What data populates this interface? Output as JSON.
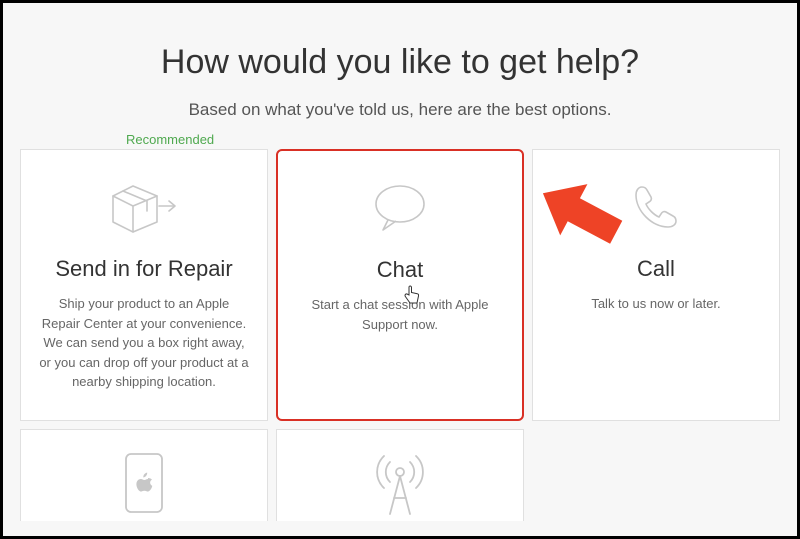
{
  "header": {
    "title": "How would you like to get help?",
    "subtitle": "Based on what you've told us, here are the best options.",
    "recommended_label": "Recommended"
  },
  "options": [
    {
      "icon": "box-ship-icon",
      "title": "Send in for Repair",
      "desc": "Ship your product to an Apple Repair Center at your convenience. We can send you a box right away, or you can drop off your product at a nearby shipping location."
    },
    {
      "icon": "chat-bubble-icon",
      "title": "Chat",
      "desc": "Start a chat session with Apple Support now."
    },
    {
      "icon": "phone-icon",
      "title": "Call",
      "desc": "Talk to us now or later."
    }
  ],
  "options_row2": [
    {
      "icon": "apple-device-icon"
    },
    {
      "icon": "antenna-icon"
    }
  ]
}
